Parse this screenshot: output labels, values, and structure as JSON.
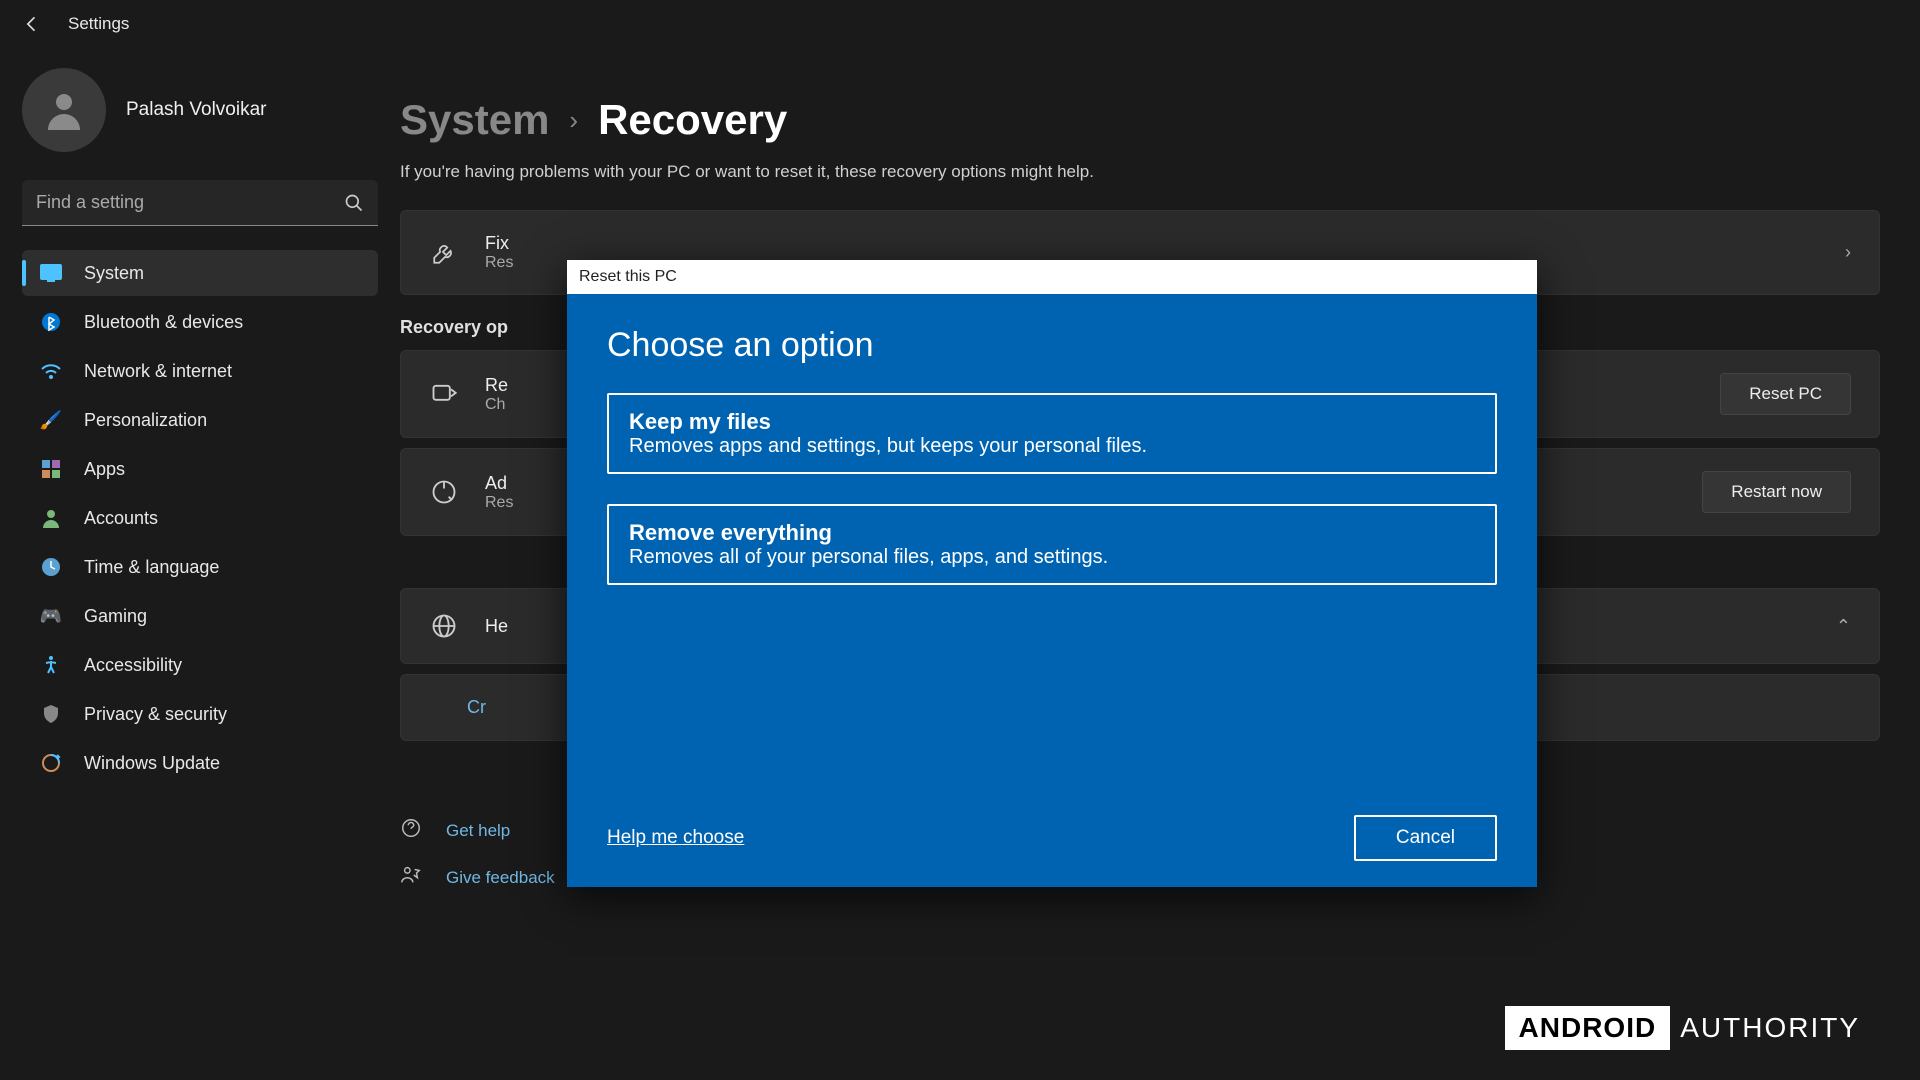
{
  "app": {
    "title": "Settings"
  },
  "user": {
    "name": "Palash Volvoikar"
  },
  "search": {
    "placeholder": "Find a setting"
  },
  "sidebar": {
    "items": [
      {
        "label": "System",
        "icon": "🖥️",
        "active": true
      },
      {
        "label": "Bluetooth & devices",
        "icon": "bt"
      },
      {
        "label": "Network & internet",
        "icon": "wifi"
      },
      {
        "label": "Personalization",
        "icon": "🖌️"
      },
      {
        "label": "Apps",
        "icon": "apps"
      },
      {
        "label": "Accounts",
        "icon": "👤"
      },
      {
        "label": "Time & language",
        "icon": "🕒"
      },
      {
        "label": "Gaming",
        "icon": "🎮"
      },
      {
        "label": "Accessibility",
        "icon": "acc"
      },
      {
        "label": "Privacy & security",
        "icon": "🛡️"
      },
      {
        "label": "Windows Update",
        "icon": "🔄"
      }
    ]
  },
  "breadcrumb": {
    "root": "System",
    "current": "Recovery"
  },
  "page": {
    "description": "If you're having problems with your PC or want to reset it, these recovery options might help."
  },
  "cards": {
    "fix": {
      "title_prefix": "Fix",
      "sub_prefix": "Res"
    },
    "recovery_section": "Recovery op",
    "reset": {
      "title_prefix": "Re",
      "sub_prefix": "Ch",
      "button": "Reset PC"
    },
    "advanced": {
      "title_prefix": "Ad",
      "sub_prefix": "Res",
      "button": "Restart now"
    },
    "help_section": {
      "title_prefix": "He"
    },
    "create": {
      "title_prefix": "Cr"
    }
  },
  "links": {
    "get_help": "Get help",
    "give_feedback": "Give feedback"
  },
  "modal": {
    "titlebar": "Reset this PC",
    "heading": "Choose an option",
    "opt1": {
      "title": "Keep my files",
      "desc": "Removes apps and settings, but keeps your personal files."
    },
    "opt2": {
      "title": "Remove everything",
      "desc": "Removes all of your personal files, apps, and settings."
    },
    "help": "Help me choose",
    "cancel": "Cancel"
  },
  "watermark": {
    "box": "ANDROID",
    "rest": "AUTHORITY"
  }
}
